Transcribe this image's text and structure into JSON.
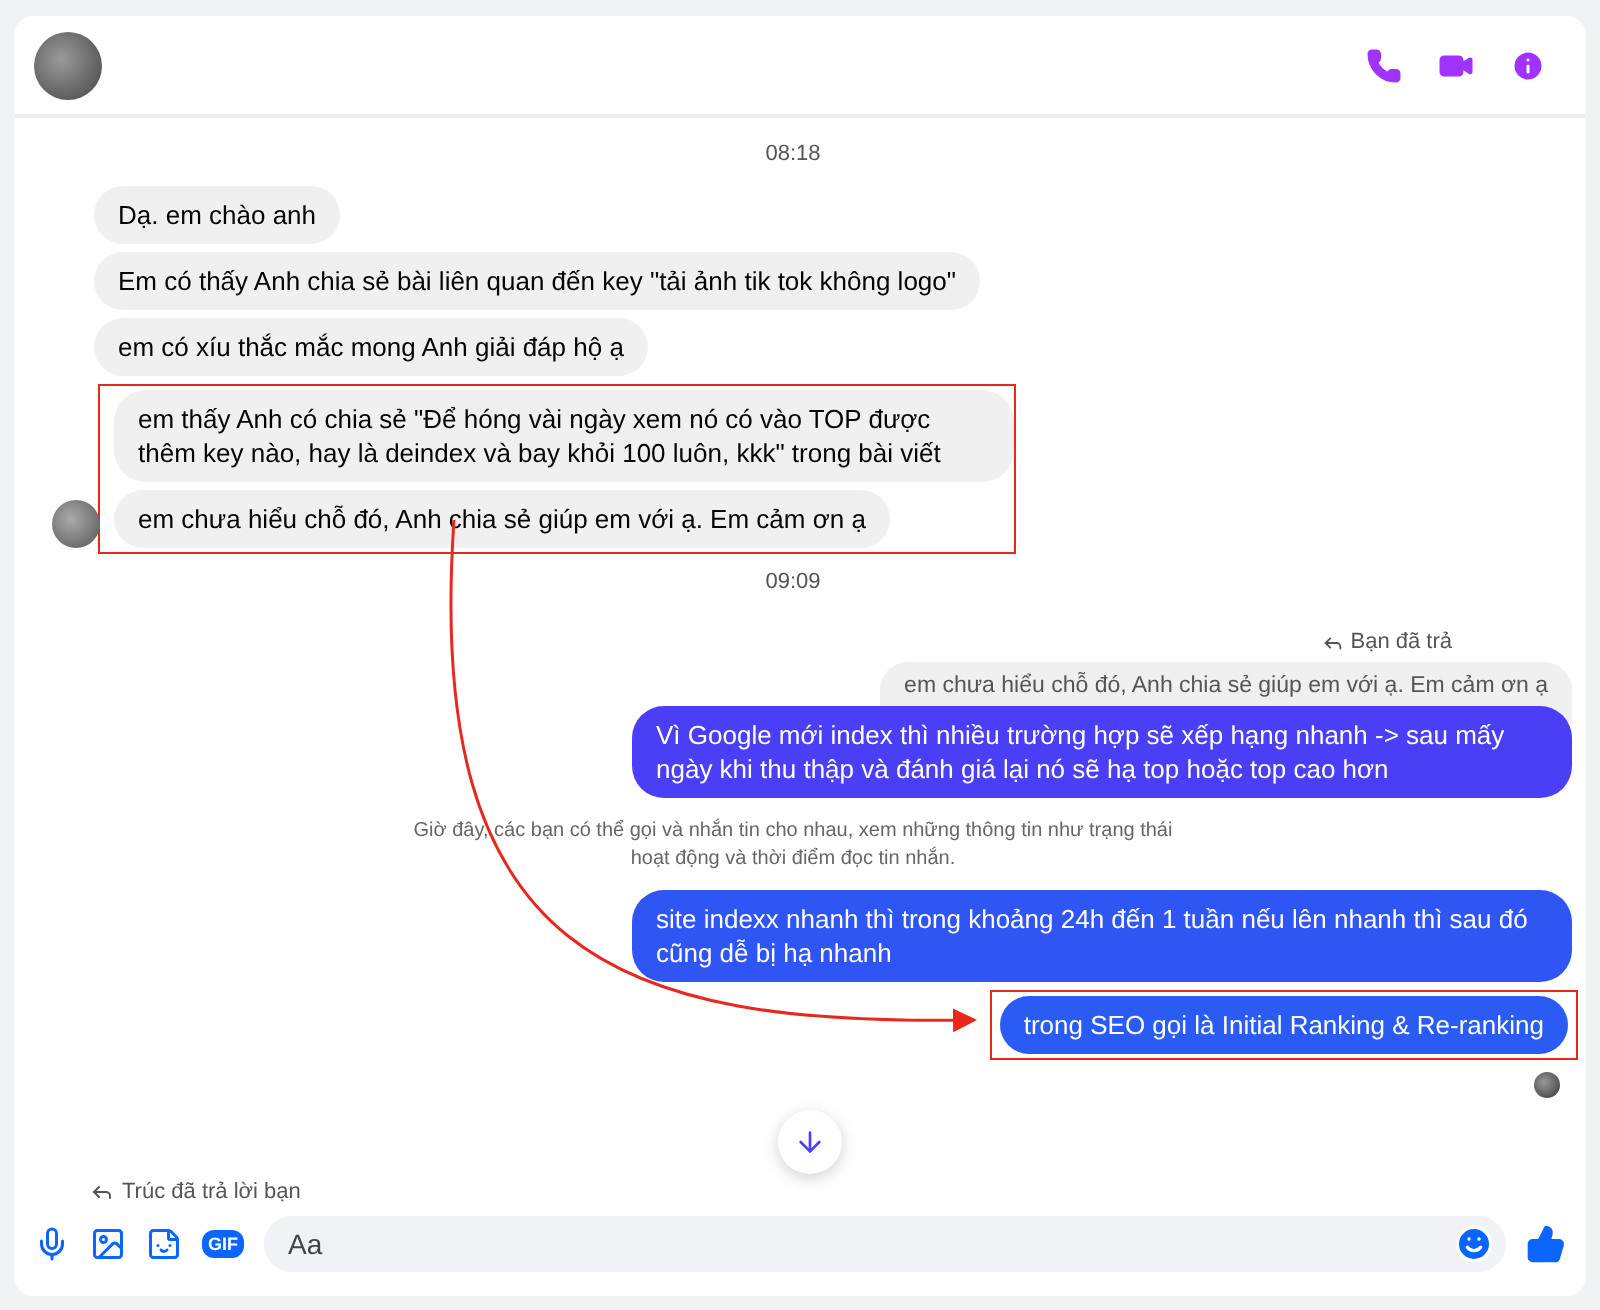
{
  "header": {
    "actions": [
      {
        "kind": "call"
      },
      {
        "kind": "video"
      },
      {
        "kind": "info"
      }
    ]
  },
  "messages": [
    {
      "kind": "time",
      "text": "08:18"
    },
    {
      "kind": "received",
      "text": "Dạ. em chào anh",
      "avatar": false,
      "highlighted": false
    },
    {
      "kind": "received",
      "text": "Em có thấy Anh chia sẻ bài liên quan đến key \"tải ảnh tik tok không logo\"",
      "avatar": false,
      "highlighted": false
    },
    {
      "kind": "received",
      "text": "em có xíu thắc mắc mong Anh giải đáp hộ ạ",
      "avatar": false,
      "highlighted": false
    },
    {
      "kind": "received",
      "text": "em thấy Anh có chia sẻ \"Để hóng vài ngày xem nó có vào TOP được thêm key nào, hay là deindex và bay khỏi 100 luôn, kkk\" trong bài viết",
      "avatar": false,
      "highlighted": true
    },
    {
      "kind": "received",
      "text": "em chưa hiểu chỗ đó, Anh chia sẻ giúp em với ạ. Em cảm ơn ạ",
      "avatar": true,
      "highlighted": true
    },
    {
      "kind": "time",
      "text": "09:09"
    },
    {
      "kind": "reply_note",
      "text": "Bạn đã trả"
    },
    {
      "kind": "quote",
      "text": "em chưa hiểu chỗ đó, Anh chia sẻ giúp em với ạ. Em cảm ơn ạ"
    },
    {
      "kind": "sent",
      "text": "Vì Google mới index thì nhiều trường hợp sẽ xếp hạng nhanh -> sau mấy ngày khi thu thập và đánh giá lại nó sẽ hạ top hoặc top cao hơn",
      "color": "#4a3ff6",
      "highlighted": false
    },
    {
      "kind": "system",
      "text": "Giờ đây, các bạn có thể gọi và nhắn tin cho nhau, xem những thông tin như trạng thái hoạt động và thời điểm đọc tin nhắn."
    },
    {
      "kind": "sent",
      "text": "site indexx nhanh thì trong khoảng 24h đến 1 tuần nếu lên nhanh thì sau đó cũng dễ bị hạ nhanh",
      "color": "#2f55f4",
      "highlighted": false
    },
    {
      "kind": "sent",
      "text": "trong SEO gọi là Initial Ranking & Re-ranking",
      "color": "#2a5cf5",
      "highlighted": true
    },
    {
      "kind": "seen"
    }
  ],
  "reply_notice": "Trúc đã trả lời bạn",
  "composer": {
    "placeholder": "Aa",
    "gif_label": "GIF"
  }
}
